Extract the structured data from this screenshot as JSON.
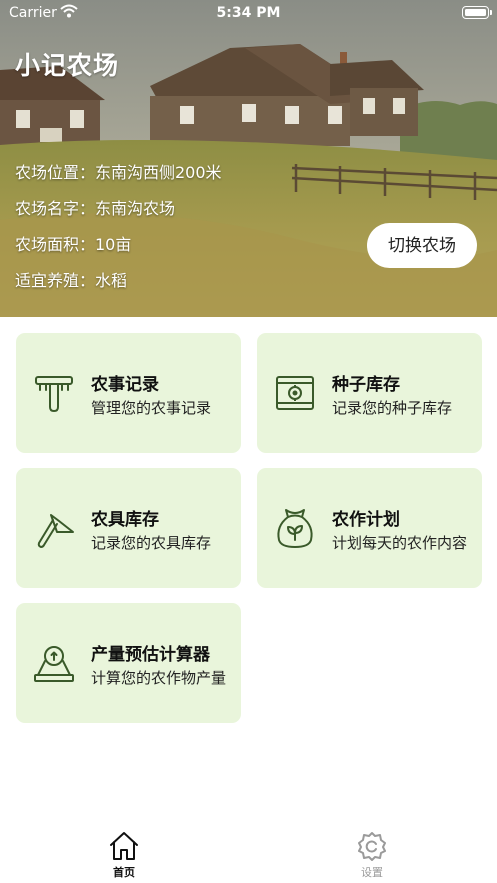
{
  "status_bar": {
    "carrier": "Carrier",
    "time": "5:34 PM"
  },
  "app": {
    "title": "小记农场"
  },
  "farm": {
    "location": "农场位置：东南沟西侧200米",
    "name": "农场名字：东南沟农场",
    "area": "农场面积：10亩",
    "crop": "适宜养殖：水稻"
  },
  "switch_button": "切换农场",
  "cards": [
    {
      "title": "农事记录",
      "subtitle": "管理您的农事记录",
      "icon": "rake-icon"
    },
    {
      "title": "种子库存",
      "subtitle": "记录您的种子库存",
      "icon": "seed-box-icon"
    },
    {
      "title": "农具库存",
      "subtitle": "记录您的农具库存",
      "icon": "hoe-icon"
    },
    {
      "title": "农作计划",
      "subtitle": "计划每天的农作内容",
      "icon": "seed-bag-icon"
    },
    {
      "title": "产量预估计算器",
      "subtitle": "计算您的农作物产量",
      "icon": "scale-icon"
    }
  ],
  "tabs": [
    {
      "label": "首页",
      "icon": "home-icon",
      "active": true
    },
    {
      "label": "设置",
      "icon": "settings-icon",
      "active": false
    }
  ],
  "colors": {
    "card_bg": "#e9f5db",
    "icon_green": "#3a5a2a",
    "tab_active": "#111111",
    "tab_inactive": "#9a9a9a"
  }
}
